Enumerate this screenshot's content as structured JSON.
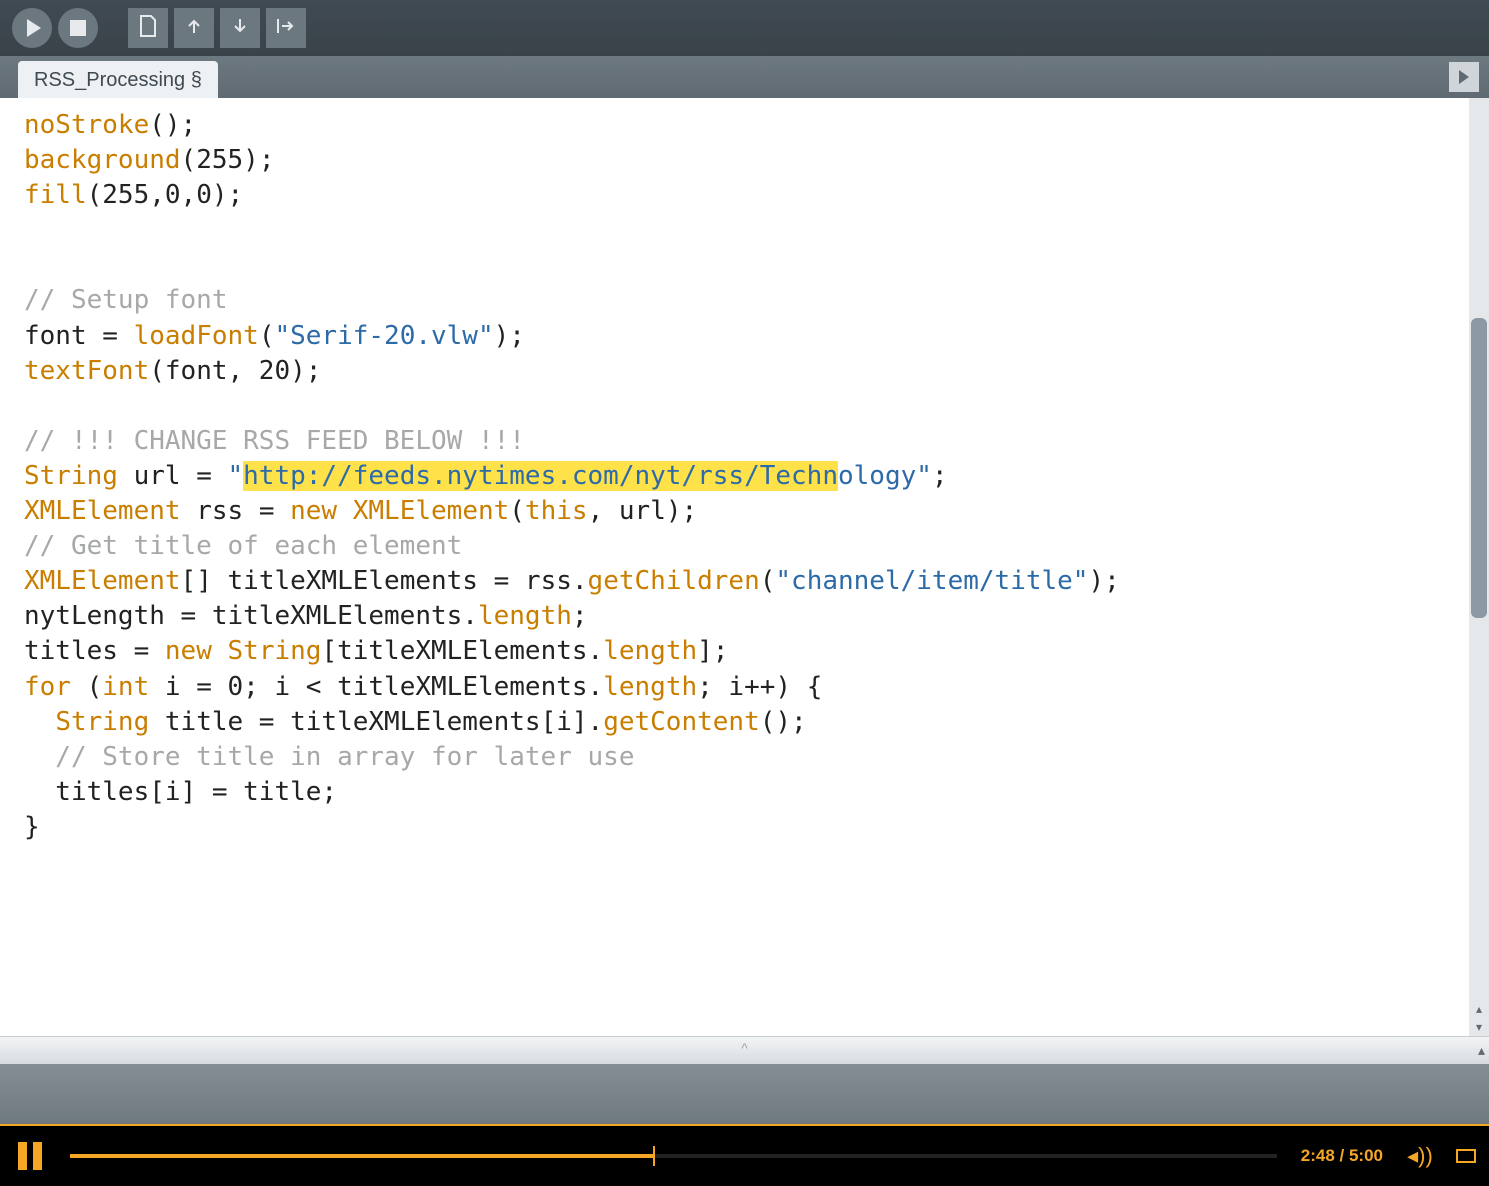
{
  "toolbar": {
    "buttons": [
      "run",
      "stop",
      "new",
      "open",
      "save",
      "export"
    ]
  },
  "tab": {
    "name": "RSS_Processing",
    "modified_mark": "§"
  },
  "code": {
    "line1_fn": "noStroke",
    "line1_rest": "();",
    "line2_fn": "background",
    "line2_rest": "(255);",
    "line3_fn": "fill",
    "line3_rest": "(255,0,0);",
    "comment_font": "// Setup font",
    "font_assign_lhs": "font = ",
    "font_assign_fn": "loadFont",
    "font_assign_open": "(",
    "font_assign_str": "\"Serif-20.vlw\"",
    "font_assign_close": ");",
    "textfont_fn": "textFont",
    "textfont_args": "(font, 20);",
    "comment_change": "// !!! CHANGE RSS FEED BELOW !!!",
    "url_type": "String",
    "url_name": " url = ",
    "url_openquote": "\"",
    "url_highlighted": "http://feeds.nytimes.com/nyt/rss/Techn",
    "url_rest": "ology\"",
    "url_semi": ";",
    "rss_type": "XMLElement",
    "rss_decl": " rss = ",
    "rss_new": "new",
    "rss_space": " ",
    "rss_ctor": "XMLElement",
    "rss_open": "(",
    "rss_this": "this",
    "rss_rest": ", url);",
    "comment_gettitle": "// Get title of each element",
    "titles1_type": "XMLElement",
    "titles1_arr": "[] titleXMLElements = rss.",
    "titles1_fn": "getChildren",
    "titles1_open": "(",
    "titles1_str": "\"channel/item/title\"",
    "titles1_close": ");",
    "nyt_lhs": "nytLength = titleXMLElements.",
    "nyt_len": "length",
    "nyt_semi": ";",
    "titles_lhs": "titles = ",
    "titles_new": "new",
    "titles_sp": " ",
    "titles_type": "String",
    "titles_open": "[titleXMLElements.",
    "titles_len": "length",
    "titles_close": "];",
    "for_kw": "for",
    "for_open": " (",
    "for_int": "int",
    "for_body": " i = 0; i < titleXMLElements.",
    "for_len": "length",
    "for_close": "; i++) {",
    "inner_indent": "  ",
    "inner_type": "String",
    "inner_decl": " title = titleXMLElements[i].",
    "inner_fn": "getContent",
    "inner_rest": "();",
    "comment_store": "  // Store title in array for later use",
    "assign_line": "  titles[i] = title;",
    "brace": "}"
  },
  "divider": {
    "grip": "^"
  },
  "player": {
    "progress_percent": 48.4,
    "current_time": "2:48",
    "total_time": "5:00",
    "separator": " / "
  }
}
